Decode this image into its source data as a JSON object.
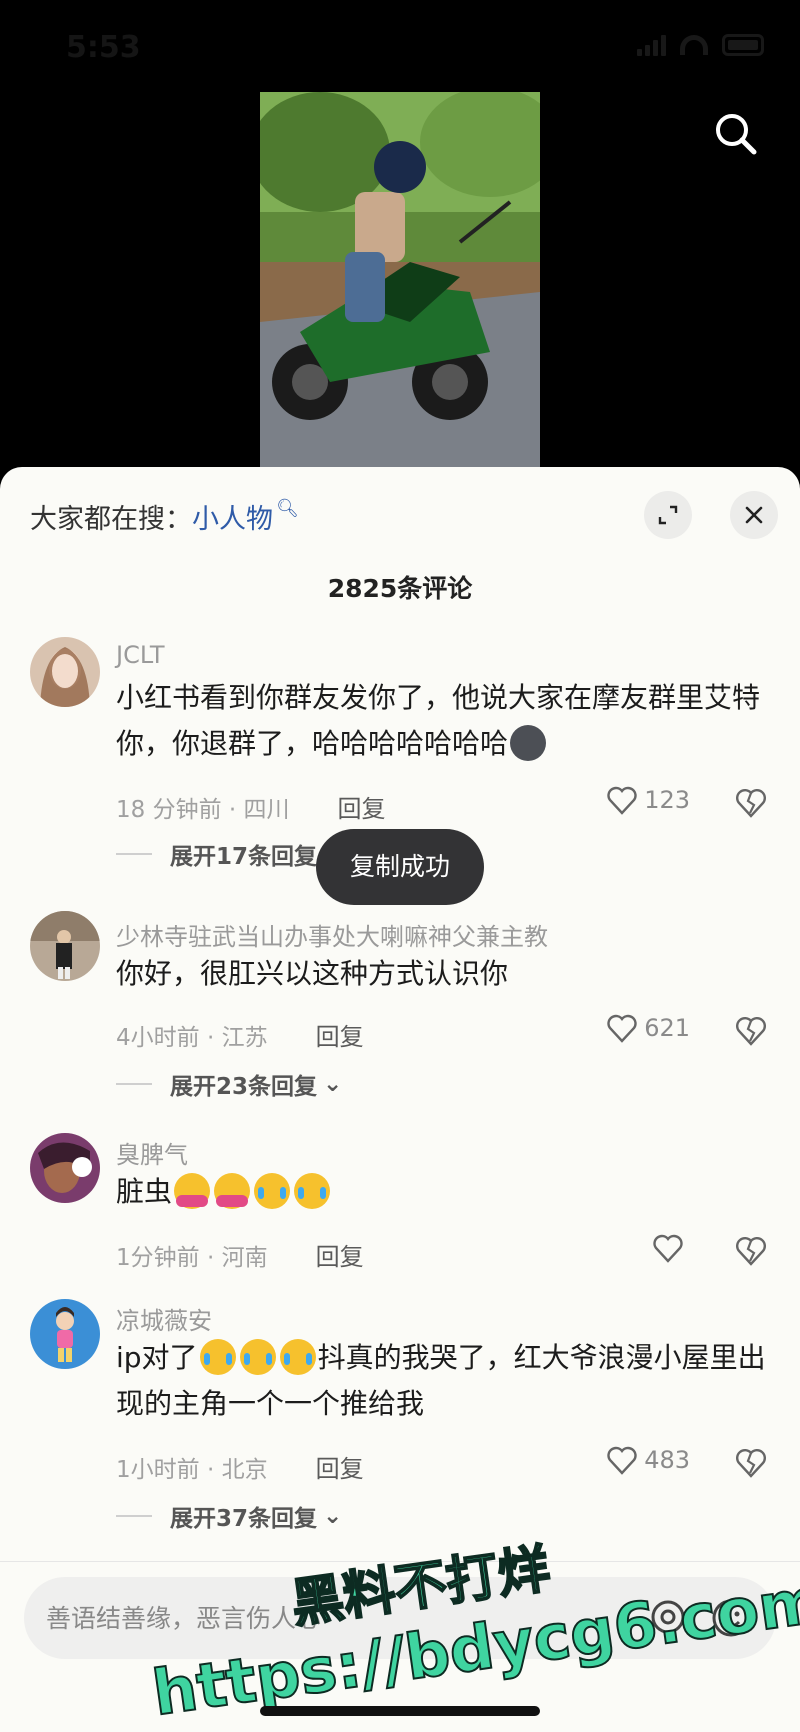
{
  "status_bar": {
    "time": "5:53"
  },
  "hot_search": {
    "prefix": "大家都在搜：",
    "term": "小人物"
  },
  "comment_count": "2825条评论",
  "comments": [
    {
      "user": "JCLT",
      "text": "小红书看到你群友发你了，他说大家在摩友群里艾特你，你退群了，哈哈哈哈哈哈哈",
      "time": "18 分钟前 · 四川",
      "reply": "回复",
      "likes": "123",
      "expand": "展开17条回复"
    },
    {
      "user": "少林寺驻武当山办事处大喇嘛神父兼主教",
      "text": "你好，很肛兴以这种方式认识你",
      "time": "4小时前 · 江苏",
      "reply": "回复",
      "likes": "621",
      "expand": "展开23条回复"
    },
    {
      "user": "臭脾气",
      "text": "脏虫",
      "time": "1分钟前 · 河南",
      "reply": "回复",
      "likes": ""
    },
    {
      "user": "凉城薇安",
      "text_a": "ip对了",
      "text_b": "抖真的我哭了，红大爷浪漫小屋里出现的主角一个一个推给我",
      "time": "1小时前 · 北京",
      "reply": "回复",
      "likes": "483",
      "expand": "展开37条回复"
    }
  ],
  "toast": "复制成功",
  "input": {
    "placeholder": "善语结善缘，恶言伤人心"
  },
  "watermark": {
    "line1": "黑料不打烊",
    "line2": "https://bdycg6.com"
  },
  "colors": {
    "sheet_bg": "#fbfbf7",
    "link_blue": "#2f5ba8",
    "toast_bg": "#333335",
    "watermark_green": "#3fd4a0"
  }
}
